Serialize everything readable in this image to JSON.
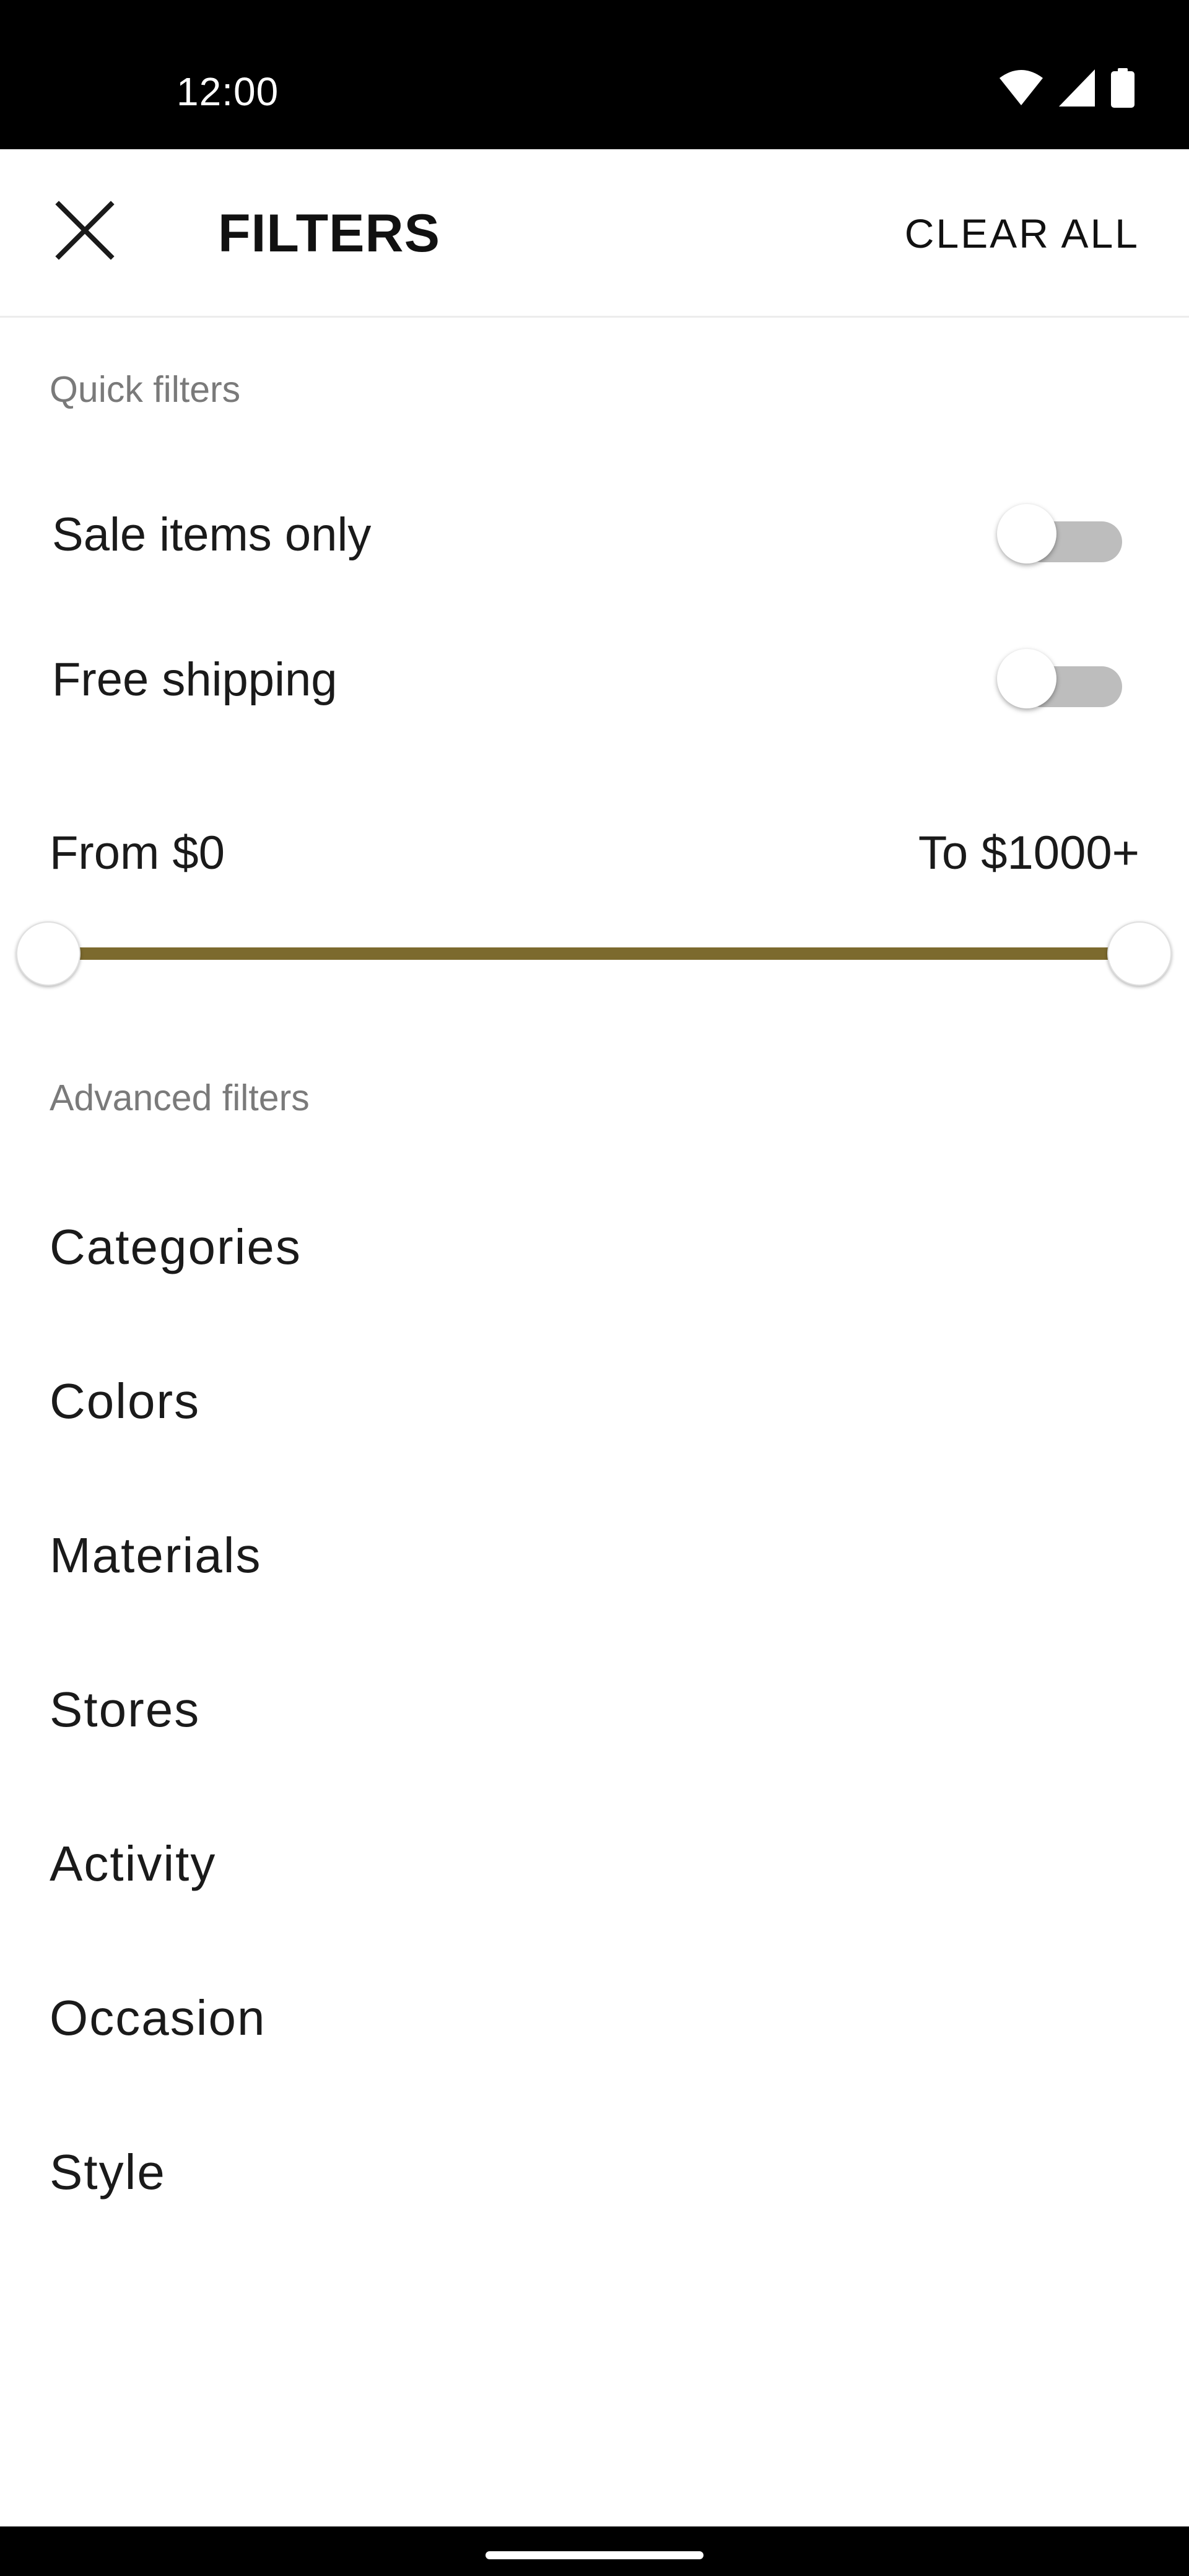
{
  "status_bar": {
    "time": "12:00",
    "icons": [
      "wifi-icon",
      "cellular-signal-icon",
      "battery-icon"
    ]
  },
  "app_bar": {
    "close_icon": "close-icon",
    "title": "FILTERS",
    "clear_all_label": "CLEAR ALL"
  },
  "quick_filters": {
    "header": "Quick filters",
    "items": [
      {
        "label": "Sale items only",
        "enabled": false
      },
      {
        "label": "Free shipping",
        "enabled": false
      }
    ]
  },
  "price_range": {
    "from_label": "From $0",
    "to_label": "To $1000+",
    "min_value": 0,
    "max_value": 1000,
    "accent_color": "#7c6a2e"
  },
  "advanced_filters": {
    "header": "Advanced filters",
    "items": [
      {
        "label": "Categories"
      },
      {
        "label": "Colors"
      },
      {
        "label": "Materials"
      },
      {
        "label": "Stores"
      },
      {
        "label": "Activity"
      },
      {
        "label": "Occasion"
      },
      {
        "label": "Style"
      }
    ]
  }
}
